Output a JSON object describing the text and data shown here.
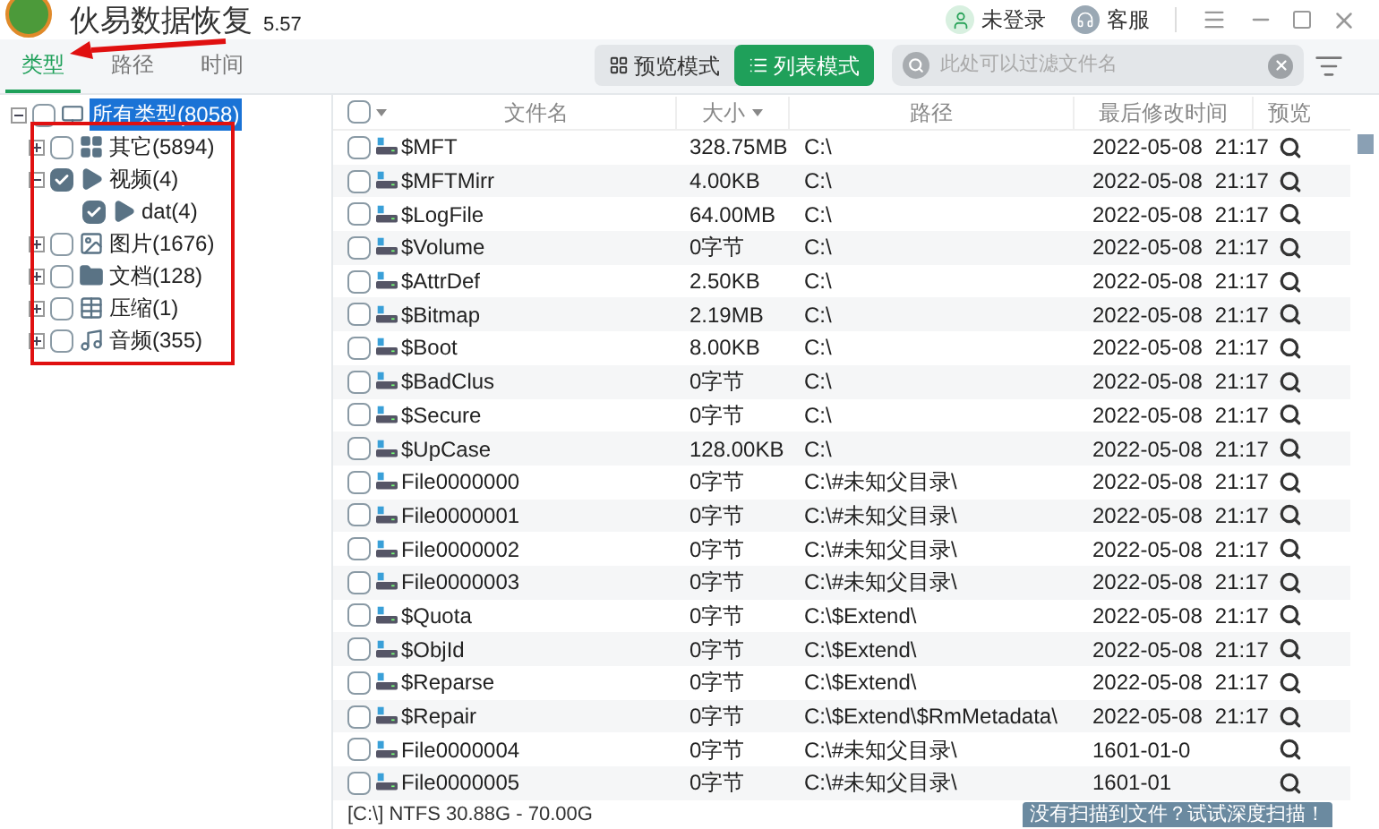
{
  "window": {
    "title": "伙易数据恢复",
    "version": "5.57",
    "user": "未登录",
    "support": "客服"
  },
  "tabs": [
    {
      "label": "类型",
      "selected": true
    },
    {
      "label": "路径",
      "selected": false
    },
    {
      "label": "时间",
      "selected": false
    }
  ],
  "view_modes": [
    {
      "label": "预览模式",
      "selected": false
    },
    {
      "label": "列表模式",
      "selected": true
    }
  ],
  "search": {
    "placeholder": "此处可以过滤文件名"
  },
  "tree": {
    "label": "所有类型(8058)",
    "checked": false,
    "expanded": true,
    "selected": true,
    "children": [
      {
        "label": "其它(5894)",
        "checked": false,
        "expanded": false
      },
      {
        "label": "视频(4)",
        "checked": true,
        "expanded": true,
        "children": [
          {
            "label": "dat(4)",
            "checked": true
          }
        ]
      },
      {
        "label": "图片(1676)",
        "checked": false,
        "expanded": false
      },
      {
        "label": "文档(128)",
        "checked": false,
        "expanded": false
      },
      {
        "label": "压缩(1)",
        "checked": false,
        "expanded": false
      },
      {
        "label": "音频(355)",
        "checked": false,
        "expanded": false
      }
    ]
  },
  "table": {
    "select_all": {
      "checked": false
    },
    "columns": [
      "文件名",
      "大小",
      "路径",
      "最后修改时间",
      "预览"
    ],
    "rows": [
      {
        "name": "$MFT",
        "size": "328.75MB",
        "path": "C:\\",
        "date": "2022-05-08",
        "time": "21:17",
        "checked": false
      },
      {
        "name": "$MFTMirr",
        "size": "4.00KB",
        "path": "C:\\",
        "date": "2022-05-08",
        "time": "21:17",
        "checked": false
      },
      {
        "name": "$LogFile",
        "size": "64.00MB",
        "path": "C:\\",
        "date": "2022-05-08",
        "time": "21:17",
        "checked": false
      },
      {
        "name": "$Volume",
        "size": "0字节",
        "path": "C:\\",
        "date": "2022-05-08",
        "time": "21:17",
        "checked": false
      },
      {
        "name": "$AttrDef",
        "size": "2.50KB",
        "path": "C:\\",
        "date": "2022-05-08",
        "time": "21:17",
        "checked": false
      },
      {
        "name": "$Bitmap",
        "size": "2.19MB",
        "path": "C:\\",
        "date": "2022-05-08",
        "time": "21:17",
        "checked": false
      },
      {
        "name": "$Boot",
        "size": "8.00KB",
        "path": "C:\\",
        "date": "2022-05-08",
        "time": "21:17",
        "checked": false
      },
      {
        "name": "$BadClus",
        "size": "0字节",
        "path": "C:\\",
        "date": "2022-05-08",
        "time": "21:17",
        "checked": false
      },
      {
        "name": "$Secure",
        "size": "0字节",
        "path": "C:\\",
        "date": "2022-05-08",
        "time": "21:17",
        "checked": false
      },
      {
        "name": "$UpCase",
        "size": "128.00KB",
        "path": "C:\\",
        "date": "2022-05-08",
        "time": "21:17",
        "checked": false
      },
      {
        "name": "File0000000",
        "size": "0字节",
        "path": "C:\\#未知父目录\\",
        "date": "2022-05-08",
        "time": "21:17",
        "checked": false
      },
      {
        "name": "File0000001",
        "size": "0字节",
        "path": "C:\\#未知父目录\\",
        "date": "2022-05-08",
        "time": "21:17",
        "checked": false
      },
      {
        "name": "File0000002",
        "size": "0字节",
        "path": "C:\\#未知父目录\\",
        "date": "2022-05-08",
        "time": "21:17",
        "checked": false
      },
      {
        "name": "File0000003",
        "size": "0字节",
        "path": "C:\\#未知父目录\\",
        "date": "2022-05-08",
        "time": "21:17",
        "checked": false
      },
      {
        "name": "$Quota",
        "size": "0字节",
        "path": "C:\\$Extend\\",
        "date": "2022-05-08",
        "time": "21:17",
        "checked": false
      },
      {
        "name": "$ObjId",
        "size": "0字节",
        "path": "C:\\$Extend\\",
        "date": "2022-05-08",
        "time": "21:17",
        "checked": false
      },
      {
        "name": "$Reparse",
        "size": "0字节",
        "path": "C:\\$Extend\\",
        "date": "2022-05-08",
        "time": "21:17",
        "checked": false
      },
      {
        "name": "$Repair",
        "size": "0字节",
        "path": "C:\\$Extend\\$RmMetadata\\",
        "date": "2022-05-08",
        "time": "21:17",
        "checked": false
      },
      {
        "name": "File0000004",
        "size": "0字节",
        "path": "C:\\#未知父目录\\",
        "date": "1601-01-0",
        "checked": false
      },
      {
        "name": "File0000005",
        "size": "0字节",
        "path": "C:\\#未知父目录\\",
        "date": "1601-01",
        "checked": false
      }
    ]
  },
  "status_bar": {
    "disk": "[C:\\] NTFS 30.88G - 70.00G",
    "deep_scan": "没有扫描到文件？试试深度扫描！"
  }
}
